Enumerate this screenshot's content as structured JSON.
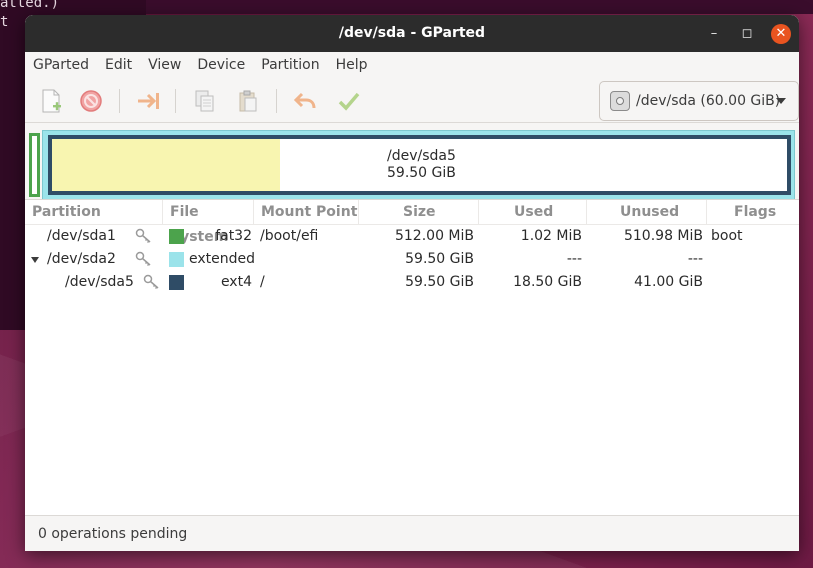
{
  "background": {
    "terminal_line_1": "atted.)",
    "terminal_line_2": "t"
  },
  "window": {
    "title": "/dev/sda - GParted"
  },
  "menu": [
    "GParted",
    "Edit",
    "View",
    "Device",
    "Partition",
    "Help"
  ],
  "toolbar": {
    "icons": [
      "new-partition-icon",
      "delete-icon",
      "resize-move-icon",
      "copy-icon",
      "paste-icon",
      "undo-icon",
      "apply-icon"
    ],
    "device_selector": "/dev/sda (60.00 GiB)"
  },
  "disk_map": {
    "partition_name": "/dev/sda5",
    "partition_size": "59.50 GiB",
    "used_fraction": 0.31,
    "colors": {
      "fat32": "#4ca34c",
      "extended": "#9be3ea",
      "ext4": "#2f4c66",
      "used": "#f8f5b0"
    }
  },
  "table": {
    "headers": [
      "Partition",
      "File System",
      "Mount Point",
      "Size",
      "Used",
      "Unused",
      "Flags"
    ],
    "rows": [
      {
        "partition": "/dev/sda1",
        "fs": "fat32",
        "fs_color": "#4ca34c",
        "mount": "/boot/efi",
        "size": "512.00 MiB",
        "used": "1.02 MiB",
        "unused": "510.98 MiB",
        "flags": "boot"
      },
      {
        "partition": "/dev/sda2",
        "fs": "extended",
        "fs_color": "#9be3ea",
        "mount": "",
        "size": "59.50 GiB",
        "used": "---",
        "unused": "---",
        "flags": ""
      },
      {
        "partition": "/dev/sda5",
        "fs": "ext4",
        "fs_color": "#2f4c66",
        "mount": "/",
        "size": "59.50 GiB",
        "used": "18.50 GiB",
        "unused": "41.00 GiB",
        "flags": ""
      }
    ]
  },
  "status": {
    "text": "0 operations pending"
  }
}
